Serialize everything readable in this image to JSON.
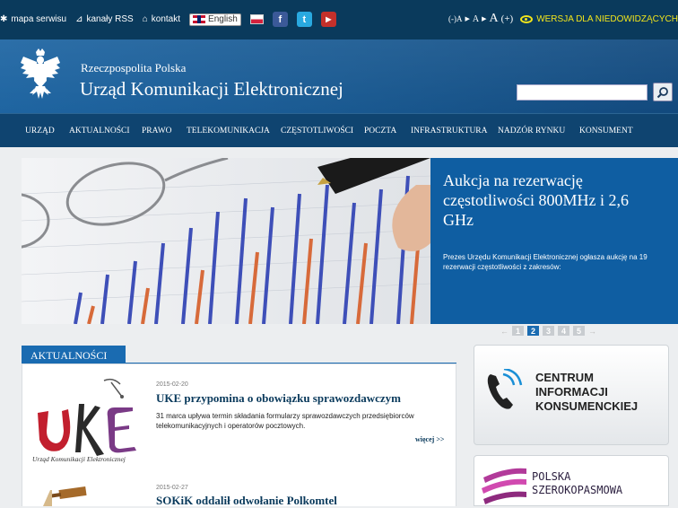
{
  "topbar": {
    "links": [
      {
        "label": "mapa serwisu",
        "icon": "sitemap-icon"
      },
      {
        "label": "kanały RSS",
        "icon": "rss-icon"
      },
      {
        "label": "kontakt",
        "icon": "home-icon"
      }
    ],
    "english_label": "English",
    "social": [
      {
        "icon": "facebook-icon",
        "glyph": "f",
        "color": "#3b5998"
      },
      {
        "icon": "twitter-icon",
        "glyph": "t",
        "color": "#29a9e0"
      },
      {
        "icon": "youtube-icon",
        "glyph": "▶",
        "color": "#c4302b"
      }
    ],
    "font_size": {
      "decrease": "(-)A",
      "normal": "A",
      "large": "A",
      "increase": "(+)"
    },
    "accessibility_label": "WERSJA DLA NIEDOWIDZĄCYCH"
  },
  "header": {
    "subtitle": "Rzeczpospolita Polska",
    "title": "Urząd Komunikacji Elektronicznej",
    "search_value": ""
  },
  "nav": [
    "URZĄD",
    "AKTUALNOŚCI",
    "PRAWO",
    "TELEKOMUNIKACJA",
    "CZĘSTOTLIWOŚCI",
    "POCZTA",
    "INFRASTRUKTURA",
    "NADZÓR RYNKU",
    "KONSUMENT"
  ],
  "hero": {
    "title": "Aukcja na rezerwację częstotliwości 800MHz i 2,6 GHz",
    "desc": "Prezes Urzędu Komunikacji Elektronicznej ogłasza aukcję na 19 rezerwacji częstotliwości z zakresów:"
  },
  "pager": {
    "prev": "←",
    "pages": [
      "1",
      "2",
      "3",
      "4",
      "5"
    ],
    "active": "2",
    "next": "→"
  },
  "news": {
    "section_title": "AKTUALNOŚCI",
    "items": [
      {
        "date": "2015-02-20",
        "title": "UKE przypomina o obowiązku sprawozdawczym",
        "text": "31 marca upływa termin składania formularzy sprawozdawczych przedsiębiorców telekomunikacyjnych i operatorów pocztowych.",
        "more": "więcej >>",
        "logo_text": "UKE",
        "logo_caption": "Urząd Komunikacji Elektronicznej"
      },
      {
        "date": "2015-02-27",
        "title": "SOKiK oddalił odwołanie Polkomtel"
      }
    ]
  },
  "side": {
    "consumer_center": "CENTRUM INFORMACJI KONSUMENCKIEJ",
    "broadband": "POLSKA SZEROKOPASMOWA"
  },
  "colors": {
    "topbar": "#0a3a5c",
    "nav": "#0f4470",
    "accent": "#1a6bb1",
    "highlight": "#f2e51b"
  }
}
